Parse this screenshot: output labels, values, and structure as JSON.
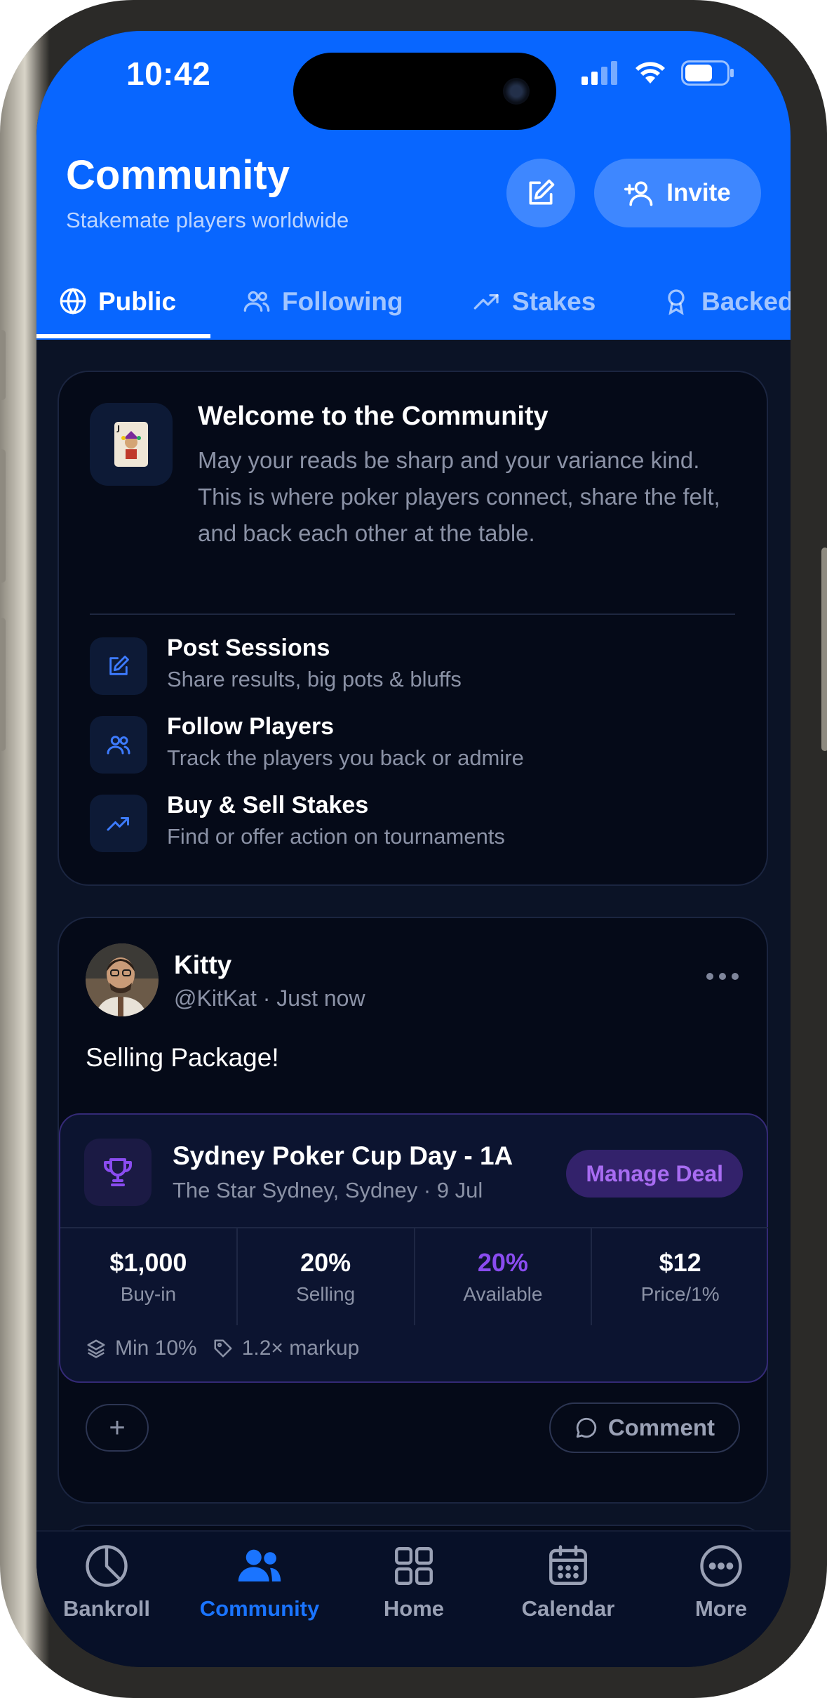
{
  "status": {
    "time": "10:42"
  },
  "header": {
    "title": "Community",
    "subtitle": "Stakemate players worldwide",
    "invite_label": "Invite",
    "brand_color": "#0866ff"
  },
  "tabs": [
    {
      "label": "Public",
      "icon": "globe-icon",
      "active": true
    },
    {
      "label": "Following",
      "icon": "users-icon",
      "active": false
    },
    {
      "label": "Stakes",
      "icon": "trending-up-icon",
      "active": false
    },
    {
      "label": "Backed",
      "icon": "award-icon",
      "active": false
    }
  ],
  "welcome": {
    "title": "Welcome to the Community",
    "body": "May your reads be sharp and your variance kind. This is where poker players connect, share the felt, and back each other at the table.",
    "features": [
      {
        "title": "Post Sessions",
        "subtitle": "Share results, big pots & bluffs",
        "icon": "edit-icon"
      },
      {
        "title": "Follow Players",
        "subtitle": "Track the players you back or admire",
        "icon": "users-icon"
      },
      {
        "title": "Buy & Sell Stakes",
        "subtitle": "Find or offer action on tournaments",
        "icon": "trending-up-icon"
      }
    ]
  },
  "post": {
    "author": "Kitty",
    "handle": "@KitKat",
    "time": "Just now",
    "meta": "@KitKat · Just now",
    "text": "Selling Package!",
    "deal": {
      "title": "Sydney Poker Cup Day - 1A",
      "subtitle": "The Star Sydney, Sydney · 9 Jul",
      "manage_label": "Manage Deal",
      "stats": [
        {
          "value": "$1,000",
          "label": "Buy-in"
        },
        {
          "value": "20%",
          "label": "Selling"
        },
        {
          "value": "20%",
          "label": "Available",
          "highlight": true
        },
        {
          "value": "$12",
          "label": "Price/1%"
        }
      ],
      "min": "Min 10%",
      "markup": "1.2× markup",
      "accent_color": "#8a4cf0"
    },
    "comment_label": "Comment"
  },
  "tabbar": [
    {
      "label": "Bankroll",
      "icon": "pie-chart-icon",
      "active": false
    },
    {
      "label": "Community",
      "icon": "users-icon",
      "active": true
    },
    {
      "label": "Home",
      "icon": "grid-icon",
      "active": false
    },
    {
      "label": "Calendar",
      "icon": "calendar-icon",
      "active": false
    },
    {
      "label": "More",
      "icon": "more-icon",
      "active": false
    }
  ]
}
